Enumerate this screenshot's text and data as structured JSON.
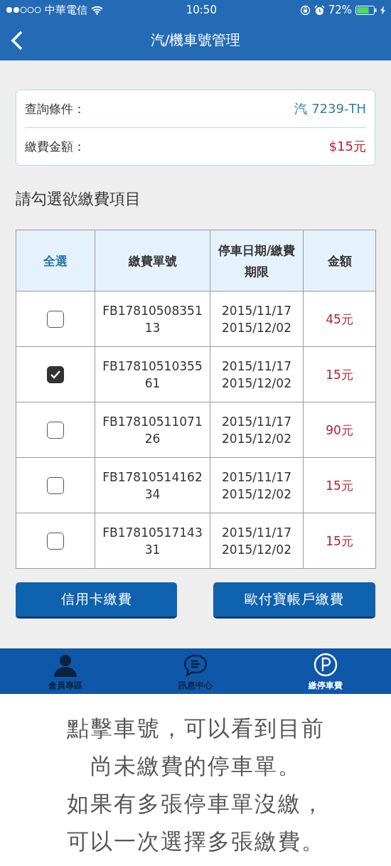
{
  "status_bar": {
    "carrier": "中華電信",
    "time": "10:50",
    "battery": "72%"
  },
  "nav": {
    "title": "汽/機車號管理"
  },
  "summary": [
    {
      "label": "查詢條件：",
      "value": "汽 7239-TH",
      "kind": "plate"
    },
    {
      "label": "繳費金額：",
      "value": "$15元",
      "kind": "amount"
    }
  ],
  "section_title": "請勾選欲繳費項目",
  "table": {
    "columns": [
      "全選",
      "繳費單號",
      "停車日期/繳費期限",
      "金額"
    ],
    "rows": [
      {
        "checked": false,
        "bill_no": "FB1781050835113",
        "date": "2015/11/17",
        "deadline": "2015/12/02",
        "amount": "45元"
      },
      {
        "checked": true,
        "bill_no": "FB1781051035561",
        "date": "2015/11/17",
        "deadline": "2015/12/02",
        "amount": "15元"
      },
      {
        "checked": false,
        "bill_no": "FB1781051107126",
        "date": "2015/11/17",
        "deadline": "2015/12/02",
        "amount": "90元"
      },
      {
        "checked": false,
        "bill_no": "FB1781051416234",
        "date": "2015/11/17",
        "deadline": "2015/12/02",
        "amount": "15元"
      },
      {
        "checked": false,
        "bill_no": "FB1781051714331",
        "date": "2015/11/17",
        "deadline": "2015/12/02",
        "amount": "15元"
      }
    ]
  },
  "buttons": [
    "信用卡繳費",
    "歐付寶帳戶繳費"
  ],
  "tab_bar": [
    {
      "label": "會員專區",
      "kind": "member",
      "selected": false
    },
    {
      "label": "訊息中心",
      "kind": "message",
      "selected": false
    },
    {
      "label": "繳停車費",
      "kind": "parking",
      "selected": true
    }
  ],
  "caption": [
    "點擊車號，可以看到目前",
    "尚未繳費的停車單。",
    "如果有多張停車單沒繳，",
    "可以一次選擇多張繳費。"
  ]
}
